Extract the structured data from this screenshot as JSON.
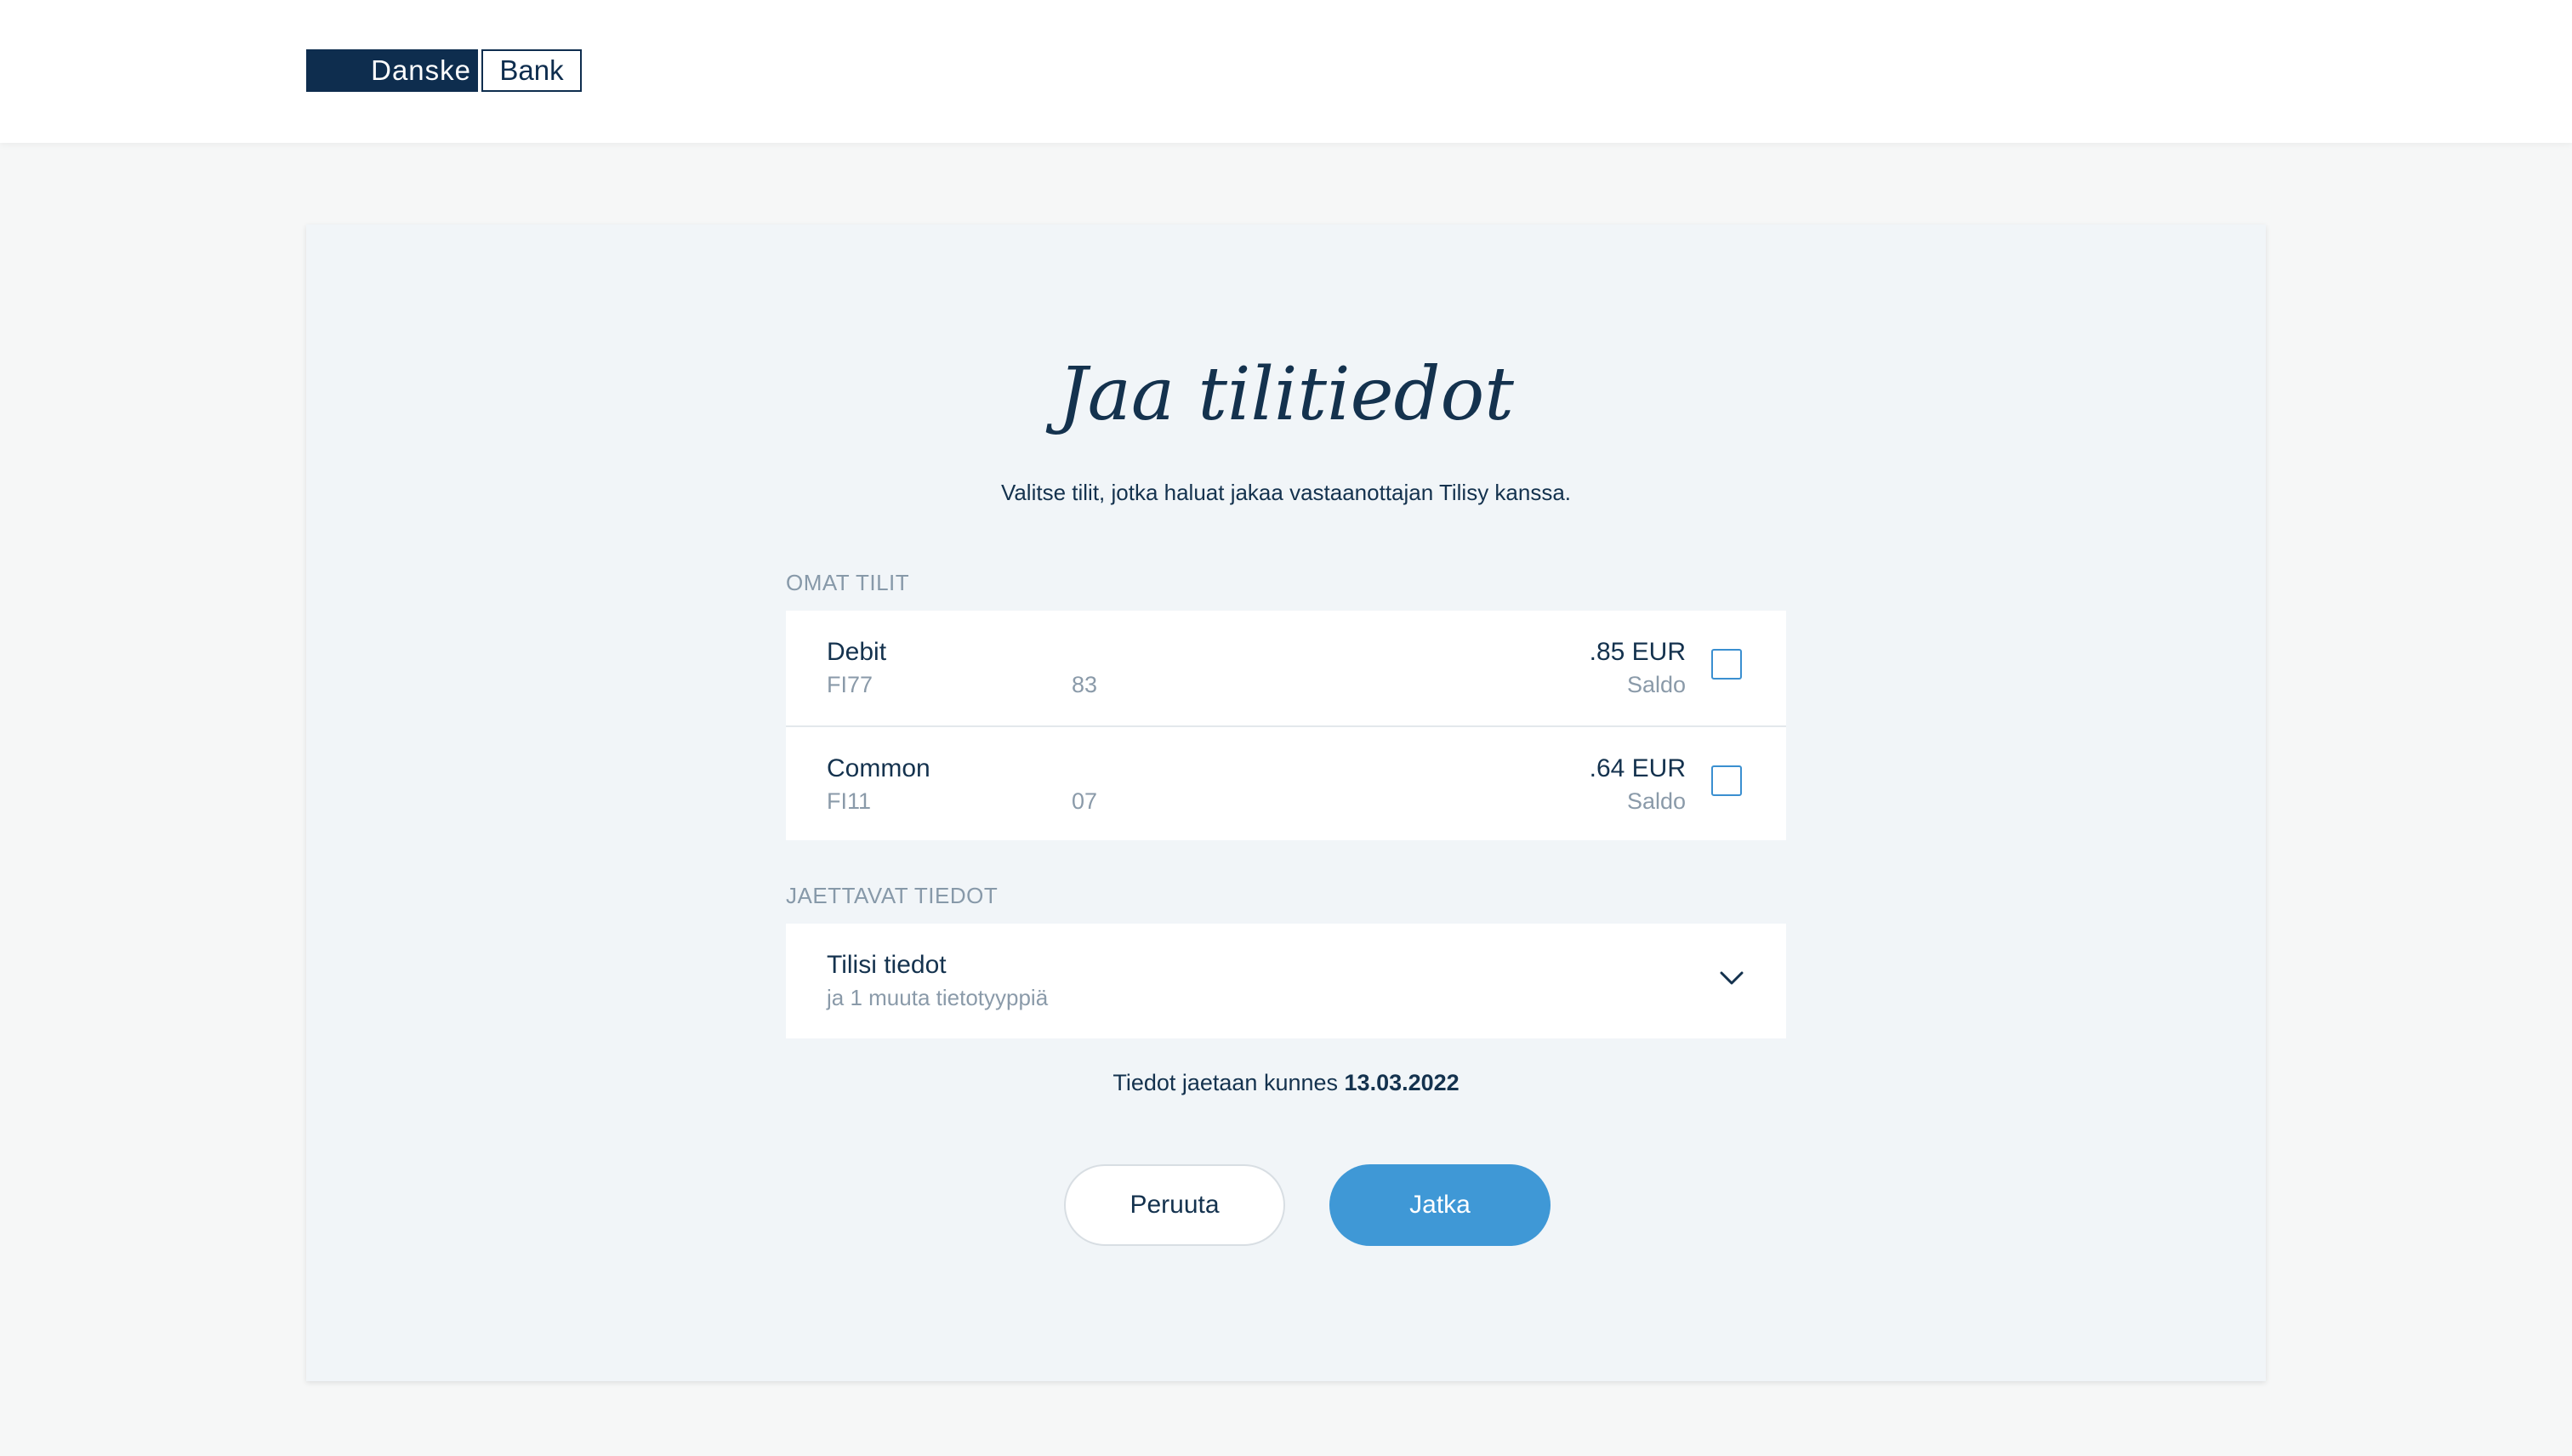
{
  "header": {
    "logo_left": "Danske",
    "logo_right": "Bank"
  },
  "page": {
    "title": "Jaa tilitiedot",
    "subtitle": "Valitse tilit, jotka haluat jakaa vastaanottajan Tilisy kanssa."
  },
  "own_accounts": {
    "label": "OMAT TILIT",
    "items": [
      {
        "name": "Debit",
        "iban_start": "FI77",
        "iban_end": "83",
        "amount": ".85 EUR",
        "balance_label": "Saldo",
        "checked": false
      },
      {
        "name": "Common",
        "iban_start": "FI11",
        "iban_end": "07",
        "amount": ".64 EUR",
        "balance_label": "Saldo",
        "checked": false
      }
    ]
  },
  "shared_data": {
    "label": "JAETTAVAT TIEDOT",
    "title": "Tilisi tiedot",
    "subtitle": "ja 1 muuta tietotyyppiä",
    "icon": "chevron-down-icon"
  },
  "expiry": {
    "prefix": "Tiedot jaetaan kunnes",
    "date": "13.03.2022"
  },
  "actions": {
    "cancel_label": "Peruuta",
    "continue_label": "Jatka"
  },
  "colors": {
    "brand_navy": "#0e2d4e",
    "accent_blue": "#3f98d6",
    "card_bg": "#f1f5f8"
  }
}
